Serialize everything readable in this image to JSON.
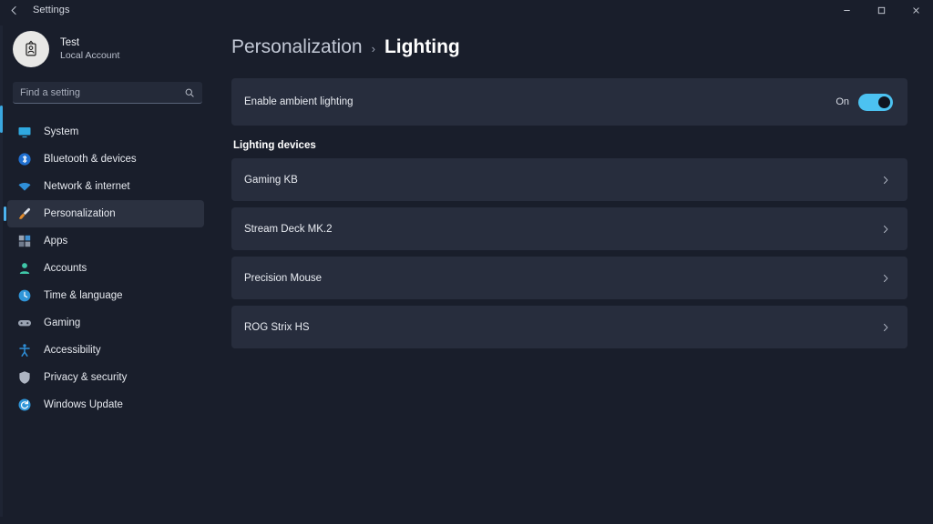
{
  "titlebar": {
    "back_label": "←",
    "app_title": "Settings",
    "minimize": "minimize-button",
    "maximize": "maximize-button",
    "close": "close-button"
  },
  "account": {
    "name": "Test",
    "subtitle": "Local Account",
    "avatar_icon": "id-badge-icon"
  },
  "search": {
    "placeholder": "Find a setting",
    "value": "",
    "icon": "search-icon"
  },
  "sidebar": {
    "items": [
      {
        "label": "System",
        "icon": "display-icon",
        "color": "#2fa9e0",
        "selected": false
      },
      {
        "label": "Bluetooth & devices",
        "icon": "bluetooth-icon",
        "color": "#1f6fd0",
        "selected": false
      },
      {
        "label": "Network & internet",
        "icon": "network-icon",
        "color": "#2f8fd8",
        "selected": false
      },
      {
        "label": "Personalization",
        "icon": "paintbrush-icon",
        "color": "#e08a2c",
        "selected": true
      },
      {
        "label": "Apps",
        "icon": "apps-icon",
        "color": "#7d8799",
        "selected": false
      },
      {
        "label": "Accounts",
        "icon": "person-icon",
        "color": "#3fc7a8",
        "selected": false
      },
      {
        "label": "Time & language",
        "icon": "clock-icon",
        "color": "#2f95d8",
        "selected": false
      },
      {
        "label": "Gaming",
        "icon": "gamepad-icon",
        "color": "#9aa3b2",
        "selected": false
      },
      {
        "label": "Accessibility",
        "icon": "accessibility-icon",
        "color": "#2f8fd8",
        "selected": false
      },
      {
        "label": "Privacy & security",
        "icon": "shield-icon",
        "color": "#aeb5c2",
        "selected": false
      },
      {
        "label": "Windows Update",
        "icon": "update-icon",
        "color": "#2f95d8",
        "selected": false
      }
    ]
  },
  "breadcrumb": {
    "parent": "Personalization",
    "separator": "›",
    "current": "Lighting"
  },
  "ambient": {
    "label": "Enable ambient lighting",
    "state_text": "On",
    "enabled": true,
    "accent_color": "#4cc2f1"
  },
  "devices_section": {
    "title": "Lighting devices",
    "items": [
      {
        "name": "Gaming KB",
        "chevron": "chevron-right-icon"
      },
      {
        "name": "Stream Deck MK.2",
        "chevron": "chevron-right-icon"
      },
      {
        "name": "Precision Mouse",
        "chevron": "chevron-right-icon"
      },
      {
        "name": "ROG Strix HS",
        "chevron": "chevron-right-icon"
      }
    ]
  }
}
